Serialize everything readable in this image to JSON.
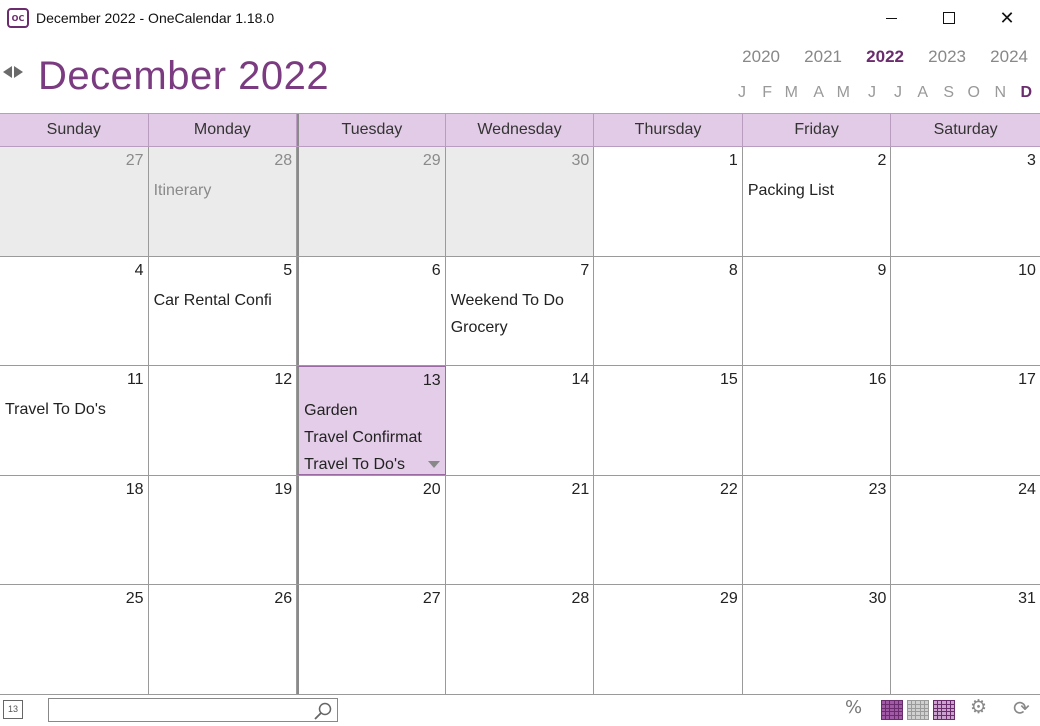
{
  "window": {
    "title": "December 2022 - OneCalendar 1.18.0",
    "icon_label": "OC"
  },
  "header": {
    "month_title": "December 2022",
    "years": [
      "2020",
      "2021",
      "2022",
      "2023",
      "2024"
    ],
    "current_year": "2022",
    "months": [
      "J",
      "F",
      "M",
      "A",
      "M",
      "J",
      "J",
      "A",
      "S",
      "O",
      "N",
      "D"
    ],
    "current_month_index": 11
  },
  "calendar": {
    "weekdays": [
      "Sunday",
      "Monday",
      "Tuesday",
      "Wednesday",
      "Thursday",
      "Friday",
      "Saturday"
    ],
    "weeks": [
      [
        {
          "day": "27",
          "other": true,
          "events": []
        },
        {
          "day": "28",
          "other": true,
          "events": [
            "Itinerary"
          ]
        },
        {
          "day": "29",
          "other": true,
          "events": []
        },
        {
          "day": "30",
          "other": true,
          "events": []
        },
        {
          "day": "1",
          "events": []
        },
        {
          "day": "2",
          "events": [
            "Packing List"
          ]
        },
        {
          "day": "3",
          "events": []
        }
      ],
      [
        {
          "day": "4",
          "events": []
        },
        {
          "day": "5",
          "events": [
            "Car Rental Confi"
          ]
        },
        {
          "day": "6",
          "events": []
        },
        {
          "day": "7",
          "events": [
            "Weekend To Do",
            "Grocery"
          ]
        },
        {
          "day": "8",
          "events": []
        },
        {
          "day": "9",
          "events": []
        },
        {
          "day": "10",
          "events": []
        }
      ],
      [
        {
          "day": "11",
          "events": [
            "Travel To Do's"
          ]
        },
        {
          "day": "12",
          "events": []
        },
        {
          "day": "13",
          "today": true,
          "more": true,
          "events": [
            "Garden",
            "Travel Confirmat",
            "Travel To Do's"
          ]
        },
        {
          "day": "14",
          "events": []
        },
        {
          "day": "15",
          "events": []
        },
        {
          "day": "16",
          "events": []
        },
        {
          "day": "17",
          "events": []
        }
      ],
      [
        {
          "day": "18",
          "events": []
        },
        {
          "day": "19",
          "events": []
        },
        {
          "day": "20",
          "events": []
        },
        {
          "day": "21",
          "events": []
        },
        {
          "day": "22",
          "events": []
        },
        {
          "day": "23",
          "events": []
        },
        {
          "day": "24",
          "events": []
        }
      ],
      [
        {
          "day": "25",
          "events": []
        },
        {
          "day": "26",
          "events": []
        },
        {
          "day": "27",
          "events": []
        },
        {
          "day": "28",
          "events": []
        },
        {
          "day": "29",
          "events": []
        },
        {
          "day": "30",
          "events": []
        },
        {
          "day": "31",
          "events": []
        }
      ]
    ]
  },
  "bottombar": {
    "today_icon_label": "13",
    "search_placeholder": "",
    "percent_icon": "%"
  },
  "colors": {
    "accent": "#7b3b80",
    "header_bg": "#e2cbe6",
    "today_bg": "#e4cde8",
    "other_month_bg": "#ebebeb"
  }
}
